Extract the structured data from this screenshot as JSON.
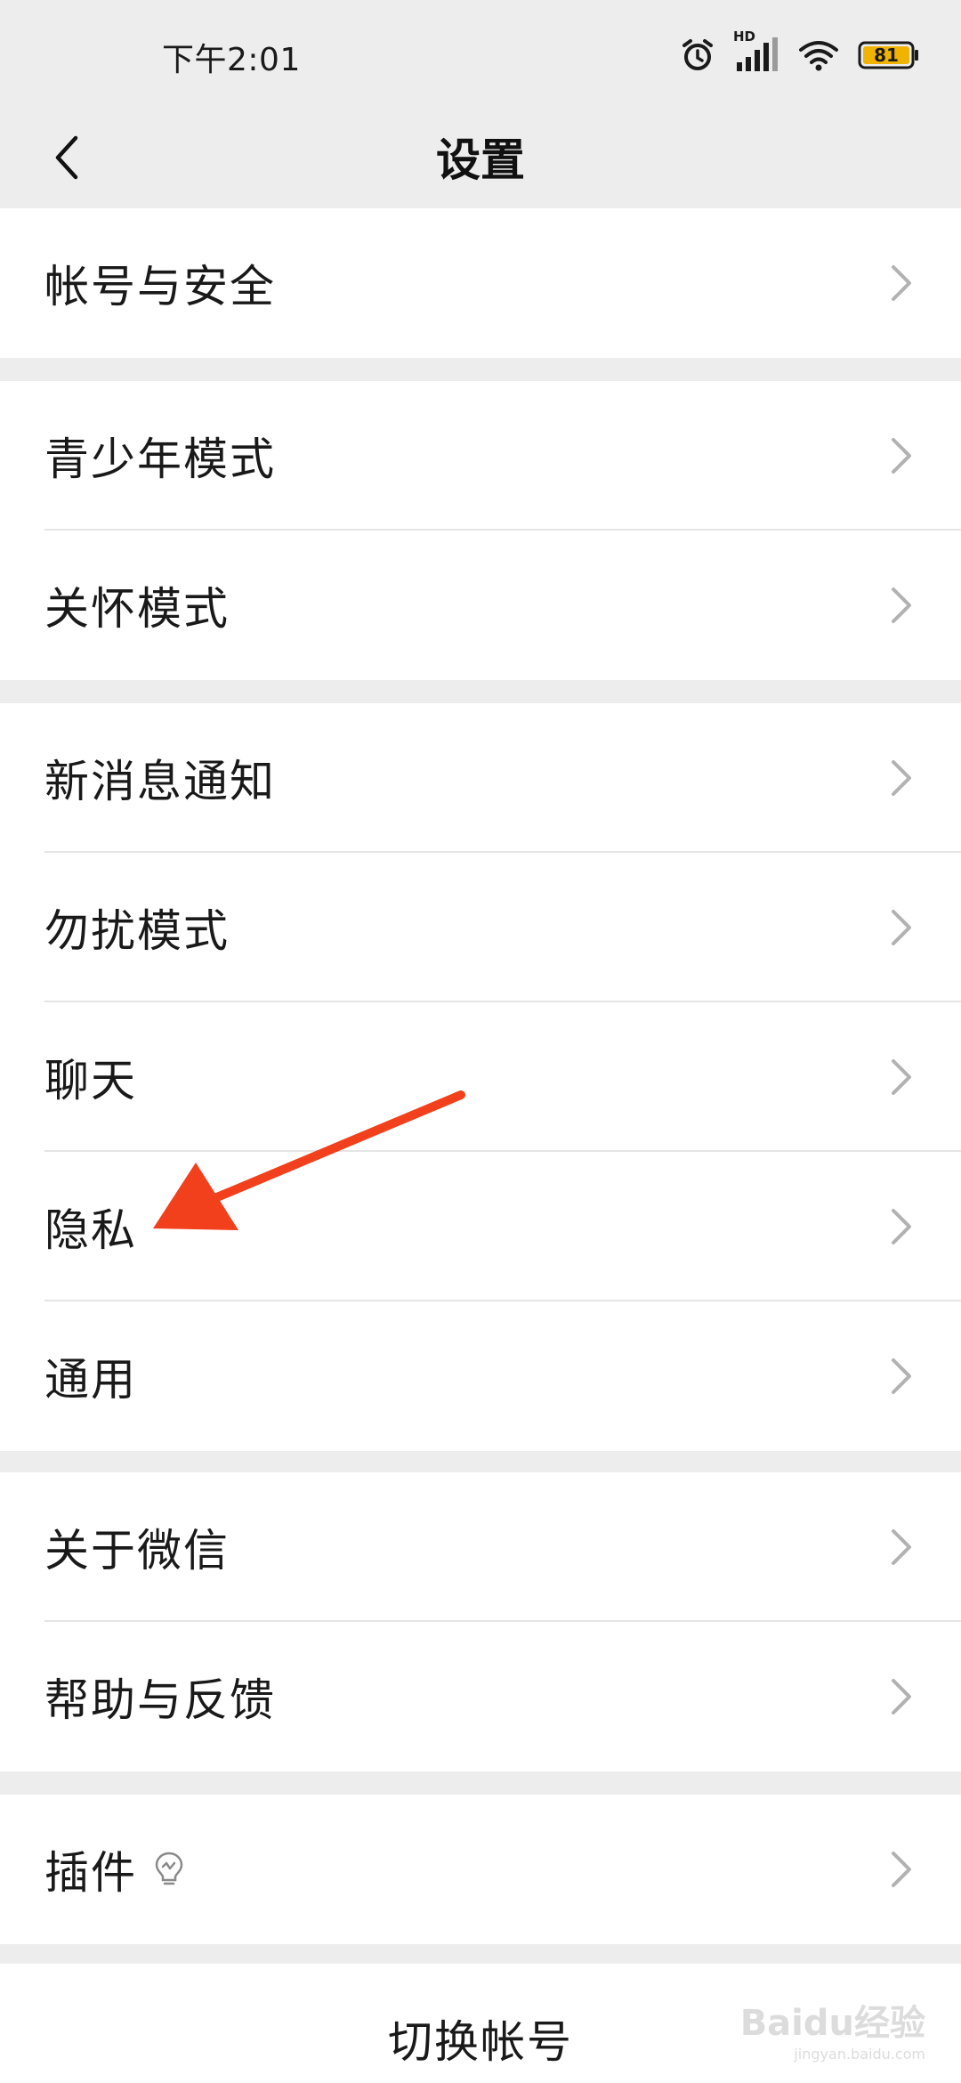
{
  "status_bar": {
    "time": "下午2:01",
    "network_label": "HD",
    "battery": "81",
    "icons": [
      "alarm-icon",
      "signal-icon",
      "wifi-icon",
      "battery-icon"
    ],
    "battery_color": "#f0b400"
  },
  "header": {
    "title": "设置",
    "back_icon": "chevron-left-icon"
  },
  "groups": [
    {
      "items": [
        {
          "label": "帐号与安全"
        }
      ]
    },
    {
      "items": [
        {
          "label": "青少年模式"
        },
        {
          "label": "关怀模式"
        }
      ]
    },
    {
      "items": [
        {
          "label": "新消息通知"
        },
        {
          "label": "勿扰模式"
        },
        {
          "label": "聊天"
        },
        {
          "label": "隐私"
        },
        {
          "label": "通用"
        }
      ]
    },
    {
      "items": [
        {
          "label": "关于微信"
        },
        {
          "label": "帮助与反馈"
        }
      ]
    },
    {
      "items": [
        {
          "label": "插件",
          "icon": "lightbulb-icon"
        }
      ]
    }
  ],
  "footer": {
    "switch_account_label": "切换帐号"
  },
  "annotation": {
    "arrow_color": "#f2401c",
    "points_to": "隐私"
  },
  "watermark": {
    "text": "Baidu经验",
    "subtext": "jingyan.baidu.com"
  }
}
